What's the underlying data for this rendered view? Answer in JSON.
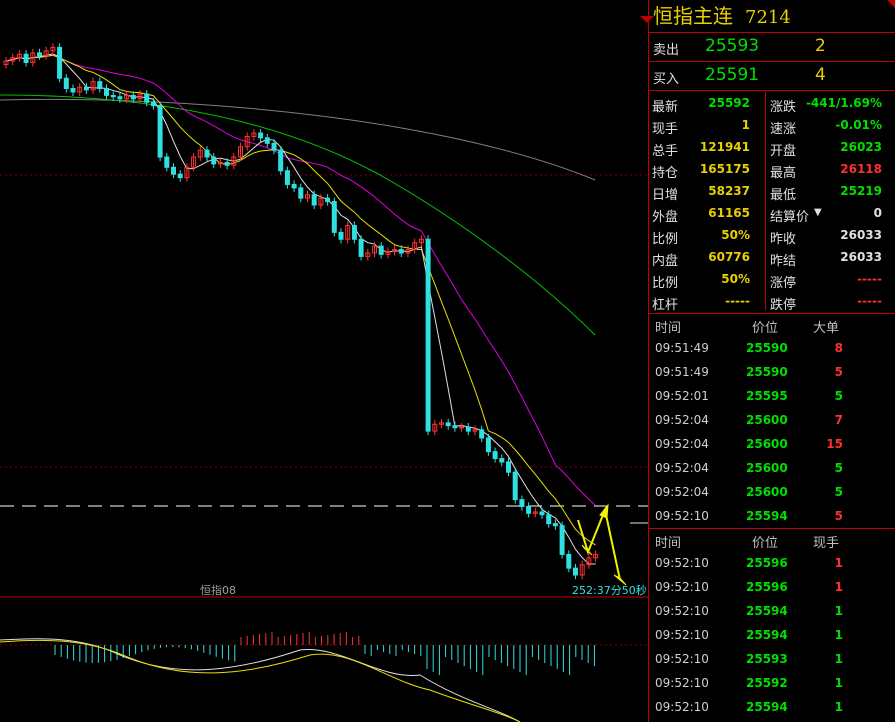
{
  "header": {
    "title": "恒指主连",
    "code": "7214"
  },
  "quotes": {
    "sell": {
      "label": "卖出",
      "price": "25593",
      "volume": "2"
    },
    "buy": {
      "label": "买入",
      "price": "25591",
      "volume": "4"
    }
  },
  "stats": [
    {
      "l1": "最新",
      "v1": "25592",
      "c1": "green",
      "l2": "涨跌",
      "v2": "-441/1.69%",
      "c2": "green"
    },
    {
      "l1": "现手",
      "v1": "1",
      "c1": "yellow",
      "l2": "速涨",
      "v2": "-0.01%",
      "c2": "green"
    },
    {
      "l1": "总手",
      "v1": "121941",
      "c1": "yellow",
      "l2": "开盘",
      "v2": "26023",
      "c2": "green"
    },
    {
      "l1": "持仓",
      "v1": "165175",
      "c1": "yellow",
      "l2": "最高",
      "v2": "26118",
      "c2": "red"
    },
    {
      "l1": "日增",
      "v1": "58237",
      "c1": "yellow",
      "l2": "最低",
      "v2": "25219",
      "c2": "green"
    },
    {
      "l1": "外盘",
      "v1": "61165",
      "c1": "yellow",
      "l2": "结算价",
      "v2": "0",
      "c2": "white"
    },
    {
      "l1": "比例",
      "v1": "50%",
      "c1": "yellow",
      "l2": "昨收",
      "v2": "26033",
      "c2": "white"
    },
    {
      "l1": "内盘",
      "v1": "60776",
      "c1": "yellow",
      "l2": "昨结",
      "v2": "26033",
      "c2": "white"
    },
    {
      "l1": "比例",
      "v1": "50%",
      "c1": "yellow",
      "l2": "涨停",
      "v2": "-----",
      "c2": "red"
    },
    {
      "l1": "杠杆",
      "v1": "-----",
      "c1": "yellow",
      "l2": "跌停",
      "v2": "-----",
      "c2": "red"
    }
  ],
  "ticks_big": {
    "headers": [
      "时间",
      "价位",
      "大单"
    ],
    "rows": [
      {
        "time": "09:51:49",
        "price": "25590",
        "vol": "8",
        "color": "red"
      },
      {
        "time": "09:51:49",
        "price": "25590",
        "vol": "5",
        "color": "red"
      },
      {
        "time": "09:52:01",
        "price": "25595",
        "vol": "5",
        "color": "green"
      },
      {
        "time": "09:52:04",
        "price": "25600",
        "vol": "7",
        "color": "red"
      },
      {
        "time": "09:52:04",
        "price": "25600",
        "vol": "15",
        "color": "red"
      },
      {
        "time": "09:52:04",
        "price": "25600",
        "vol": "5",
        "color": "green"
      },
      {
        "time": "09:52:04",
        "price": "25600",
        "vol": "5",
        "color": "green"
      },
      {
        "time": "09:52:10",
        "price": "25594",
        "vol": "5",
        "color": "red"
      }
    ]
  },
  "ticks_now": {
    "headers": [
      "时间",
      "价位",
      "现手"
    ],
    "rows": [
      {
        "time": "09:52:10",
        "price": "25596",
        "vol": "1",
        "color": "red"
      },
      {
        "time": "09:52:10",
        "price": "25596",
        "vol": "1",
        "color": "red"
      },
      {
        "time": "09:52:10",
        "price": "25594",
        "vol": "1",
        "color": "green"
      },
      {
        "time": "09:52:10",
        "price": "25594",
        "vol": "1",
        "color": "green"
      },
      {
        "time": "09:52:10",
        "price": "25593",
        "vol": "1",
        "color": "green"
      },
      {
        "time": "09:52:10",
        "price": "25592",
        "vol": "1",
        "color": "green"
      },
      {
        "time": "09:52:10",
        "price": "25594",
        "vol": "1",
        "color": "green"
      }
    ]
  },
  "chart": {
    "symbol_label": "恒指08",
    "countdown": "252:37分50秒",
    "colors": {
      "up": "#ff3030",
      "down": "#30e0e0",
      "ma5": "#e0e0e0",
      "ma10": "#e8e000",
      "ma20": "#e000e0",
      "ma60": "#00c000",
      "ma120": "#808080"
    }
  },
  "chart_data": {
    "type": "candlestick",
    "title": "",
    "closes": [
      25900,
      25905,
      25910,
      25898,
      25912,
      25908,
      25915,
      25920,
      25875,
      25860,
      25855,
      25862,
      25858,
      25870,
      25860,
      25850,
      25848,
      25845,
      25850,
      25845,
      25852,
      25840,
      25835,
      25760,
      25745,
      25735,
      25730,
      25745,
      25760,
      25770,
      25760,
      25750,
      25752,
      25748,
      25760,
      25775,
      25790,
      25795,
      25788,
      25780,
      25770,
      25740,
      25720,
      25715,
      25700,
      25705,
      25690,
      25700,
      25695,
      25650,
      25640,
      25660,
      25640,
      25615,
      25620,
      25630,
      25618,
      25622,
      25625,
      25620,
      25625,
      25635,
      25640,
      25360,
      25370,
      25372,
      25368,
      25365,
      25366,
      25360,
      25362,
      25350,
      25330,
      25320,
      25315,
      25300,
      25260,
      25250,
      25240,
      25242,
      25238,
      25225,
      25222,
      25180,
      25160,
      25150,
      25165,
      25175,
      25180
    ]
  }
}
